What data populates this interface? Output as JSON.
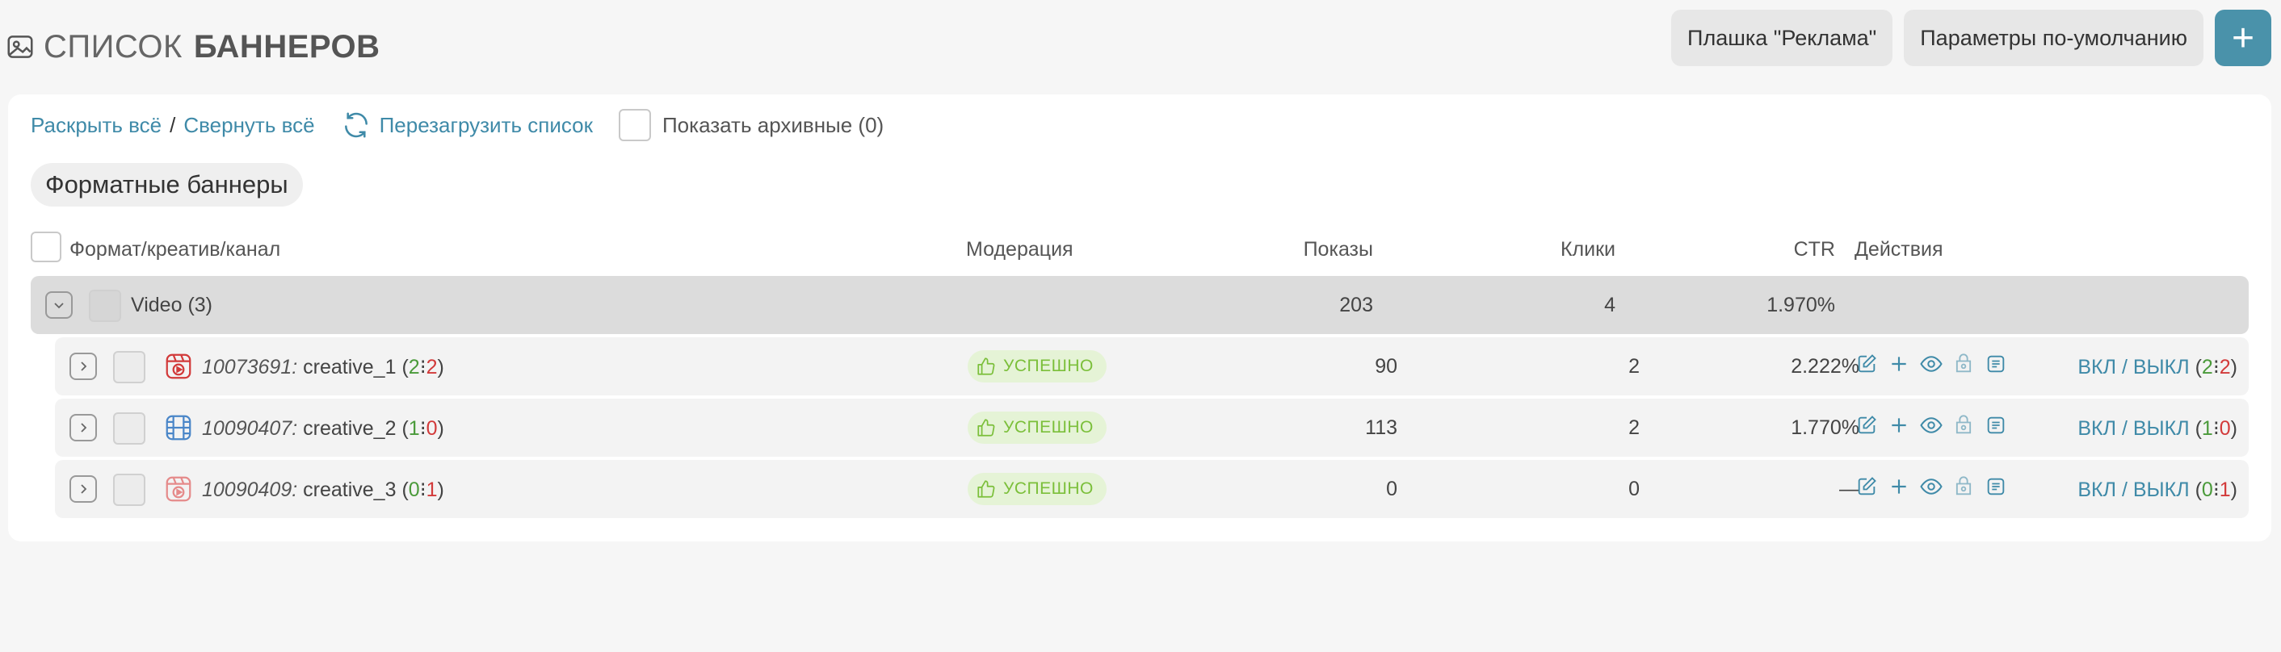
{
  "header": {
    "title_light": "СПИСОК",
    "title_bold": "БАННЕРОВ",
    "btn_ad": "Плашка \"Реклама\"",
    "btn_defaults": "Параметры по-умолчанию",
    "btn_add": "+"
  },
  "toolbar": {
    "expand_all": "Раскрыть всё",
    "separator": "/",
    "collapse_all": "Свернуть всё",
    "reload": "Перезагрузить список",
    "show_archived": "Показать архивные (0)"
  },
  "section_title": "Форматные баннеры",
  "columns": {
    "format": "Формат/креатив/канал",
    "moderation": "Модерация",
    "impressions": "Показы",
    "clicks": "Клики",
    "ctr": "CTR",
    "actions": "Действия"
  },
  "group": {
    "expander": "⌄",
    "name": "Video",
    "count": "(3)",
    "impressions": "203",
    "clicks": "4",
    "ctr": "1.970%"
  },
  "rows": [
    {
      "id": "10073691:",
      "name": "creative_1",
      "stat_open": "(",
      "stat_on": "2",
      "stat_sep": "⁝",
      "stat_off": "2",
      "stat_close": ")",
      "moderation": "УСПЕШНО",
      "impressions": "90",
      "clicks": "2",
      "ctr": "2.222%",
      "toggle": "ВКЛ / ВЫКЛ",
      "toggle_on": "2",
      "toggle_off": "2",
      "icon": "video-creative-icon-red"
    },
    {
      "id": "10090407:",
      "name": "creative_2",
      "stat_open": "(",
      "stat_on": "1",
      "stat_sep": "⁝",
      "stat_off": "0",
      "stat_close": ")",
      "moderation": "УСПЕШНО",
      "impressions": "113",
      "clicks": "2",
      "ctr": "1.770%",
      "toggle": "ВКЛ / ВЫКЛ",
      "toggle_on": "1",
      "toggle_off": "0",
      "icon": "film-icon-blue"
    },
    {
      "id": "10090409:",
      "name": "creative_3",
      "stat_open": "(",
      "stat_on": "0",
      "stat_sep": "⁝",
      "stat_off": "1",
      "stat_close": ")",
      "moderation": "УСПЕШНО",
      "impressions": "0",
      "clicks": "0",
      "ctr": "—",
      "toggle": "ВКЛ / ВЫКЛ",
      "toggle_on": "0",
      "toggle_off": "1",
      "icon": "video-creative-icon-pink"
    }
  ],
  "colors": {
    "accent": "#3f8aa8",
    "add_button": "#4a92aa",
    "success_bg": "#e5f3d6",
    "success_text": "#7bbf3a",
    "on_count": "#4a9a3a",
    "off_count": "#d23a3a"
  }
}
